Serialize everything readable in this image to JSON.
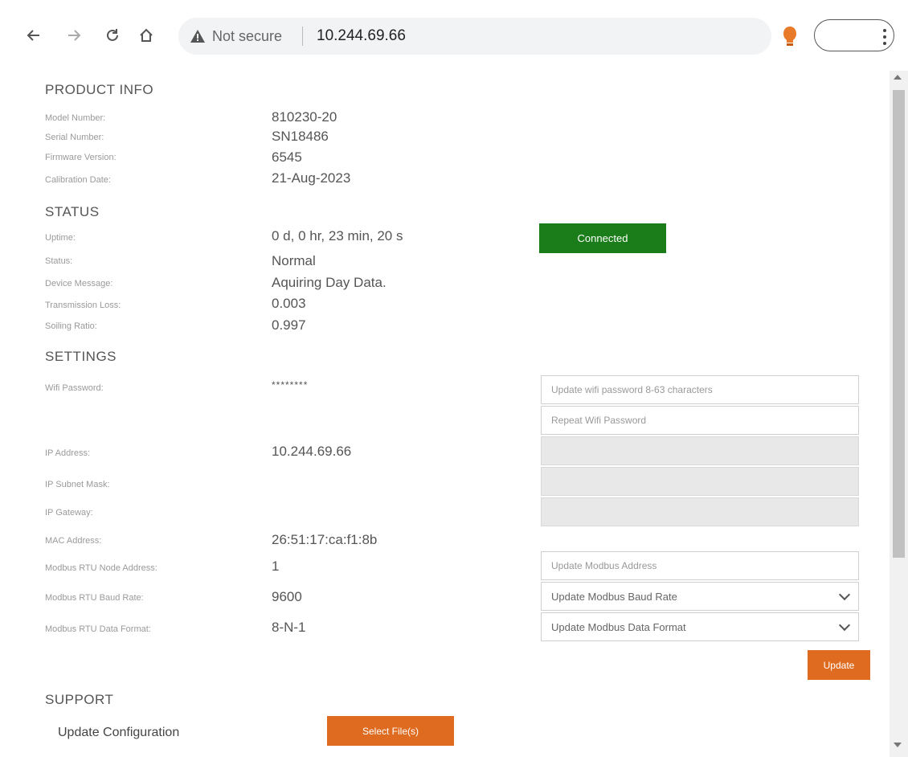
{
  "browser": {
    "security_label": "Not secure",
    "url": "10.244.69.66"
  },
  "product_info": {
    "title": "PRODUCT INFO",
    "rows": [
      {
        "label": "Model Number:",
        "value": "810230-20"
      },
      {
        "label": "Serial Number:",
        "value": "SN18486"
      },
      {
        "label": "Firmware Version:",
        "value": "6545"
      },
      {
        "label": "Calibration Date:",
        "value": "21-Aug-2023"
      }
    ]
  },
  "status": {
    "title": "STATUS",
    "rows": [
      {
        "label": "Uptime:",
        "value": "0 d, 0 hr, 23 min, 20 s"
      },
      {
        "label": "Status:",
        "value": "Normal"
      },
      {
        "label": "Device Message:",
        "value": "Aquiring Day Data."
      },
      {
        "label": "Transmission Loss:",
        "value": "0.003"
      },
      {
        "label": "Soiling Ratio:",
        "value": "0.997"
      }
    ],
    "connection_label": "Connected",
    "connection_color": "#1a7d1a"
  },
  "settings": {
    "title": "SETTINGS",
    "rows": [
      {
        "label": "Wifi Password:",
        "value": "********"
      },
      {
        "label": "IP Address:",
        "value": "10.244.69.66"
      },
      {
        "label": "IP Subnet Mask:",
        "value": ""
      },
      {
        "label": "IP Gateway:",
        "value": ""
      },
      {
        "label": "MAC Address:",
        "value": "26:51:17:ca:f1:8b"
      },
      {
        "label": "Modbus RTU Node Address:",
        "value": "1"
      },
      {
        "label": "Modbus RTU Baud Rate:",
        "value": "9600"
      },
      {
        "label": "Modbus RTU Data Format:",
        "value": "8-N-1"
      }
    ],
    "inputs": {
      "wifi_password_placeholder": "Update wifi password 8-63 characters",
      "wifi_repeat_placeholder": "Repeat Wifi Password",
      "modbus_address_placeholder": "Update Modbus Address",
      "baud_rate_select": "Update Modbus Baud Rate",
      "data_format_select": "Update Modbus Data Format"
    },
    "update_label": "Update"
  },
  "support": {
    "title": "SUPPORT",
    "update_configuration_label": "Update Configuration",
    "select_files_label": "Select File(s)"
  },
  "colors": {
    "accent_orange": "#de6b1f",
    "connected_green": "#1a7d1a"
  }
}
